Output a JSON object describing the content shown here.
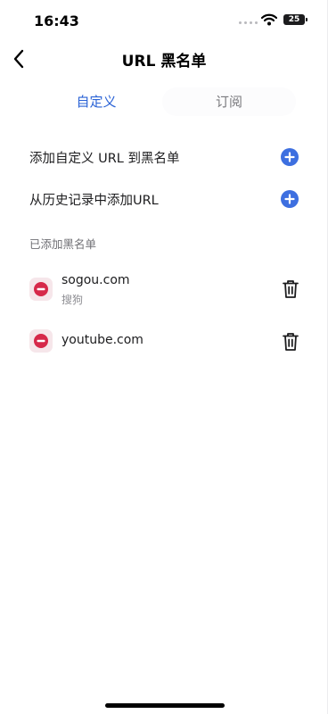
{
  "status_bar": {
    "time": "16:43",
    "battery": "25"
  },
  "nav": {
    "title": "URL 黑名单"
  },
  "tabs": [
    {
      "label": "自定义",
      "selected": true
    },
    {
      "label": "订阅",
      "selected": false
    }
  ],
  "actions": [
    {
      "label": "添加自定义 URL 到黑名单",
      "icon": "plus-circle-icon"
    },
    {
      "label": "从历史记录中添加URL",
      "icon": "plus-circle-icon"
    }
  ],
  "section_header": "已添加黑名单",
  "blacklist": [
    {
      "title": "sogou.com",
      "subtitle": "搜狗"
    },
    {
      "title": "youtube.com",
      "subtitle": ""
    }
  ],
  "colors": {
    "accent": "#2b63d6",
    "add_button": "#3d6fe0",
    "blocked_icon": "#d6294a",
    "blocked_bg": "#f6e6ea"
  }
}
